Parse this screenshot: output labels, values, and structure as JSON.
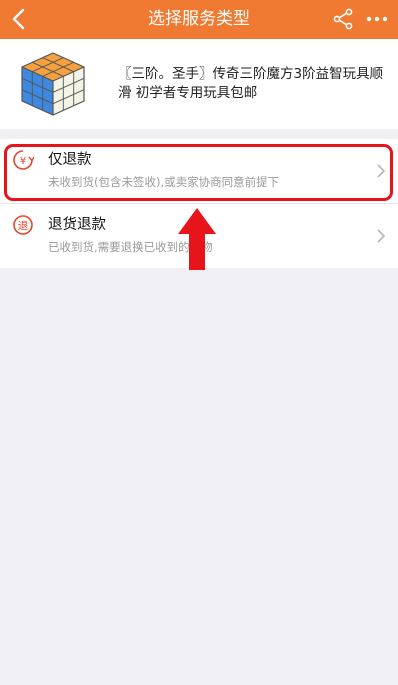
{
  "header": {
    "title": "选择服务类型",
    "background": "#f07a31",
    "icons": [
      "back-arrow-icon",
      "share-icon",
      "more-icon"
    ]
  },
  "product": {
    "title": "〖三阶。圣手〗传奇三阶魔方3阶益智玩具顺滑 初学者专用玩具包邮"
  },
  "options": [
    {
      "title": "仅退款",
      "description": "未收到货(包含未签收),或卖家协商同意前提下",
      "icon": "yuan-refund-icon"
    },
    {
      "title": "退货退款",
      "description": "已收到货,需要退换已收到的货物",
      "icon": "return-goods-icon"
    }
  ],
  "annotation": {
    "highlight_color": "#e8141c"
  }
}
